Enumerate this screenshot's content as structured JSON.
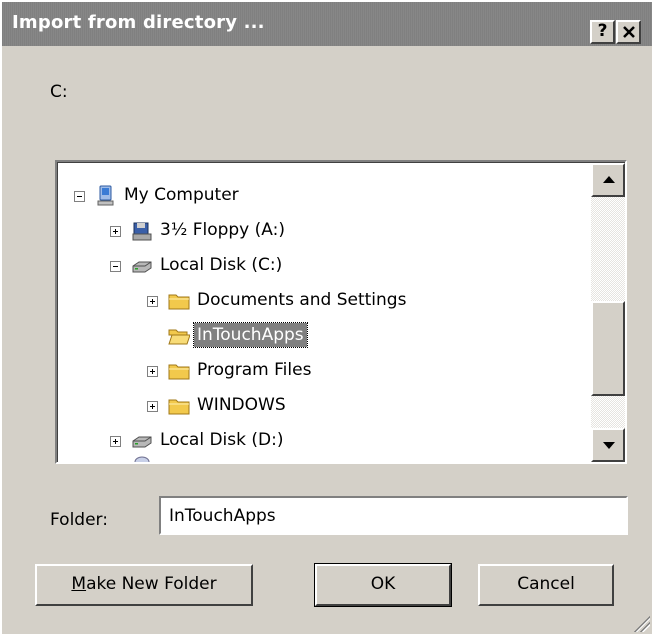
{
  "window": {
    "title": "Import from directory ...",
    "help_label": "?",
    "close_label": "✕"
  },
  "current_path": "C:",
  "tree": {
    "items": [
      {
        "label": "My Computer",
        "icon": "my-computer-icon",
        "expander": "minus"
      },
      {
        "label": "3½ Floppy (A:)",
        "icon": "floppy-drive-icon",
        "expander": "plus"
      },
      {
        "label": "Local Disk (C:)",
        "icon": "hard-disk-icon",
        "expander": "minus"
      },
      {
        "label": "Documents and Settings",
        "icon": "folder-icon",
        "expander": "plus"
      },
      {
        "label": "InTouchApps",
        "icon": "open-folder-icon",
        "expander": "none",
        "selected": true
      },
      {
        "label": "Program Files",
        "icon": "folder-icon",
        "expander": "plus"
      },
      {
        "label": "WINDOWS",
        "icon": "folder-icon",
        "expander": "plus"
      },
      {
        "label": "Local Disk (D:)",
        "icon": "hard-disk-icon",
        "expander": "plus"
      }
    ]
  },
  "folder": {
    "label": "Folder:",
    "value": "InTouchApps"
  },
  "buttons": {
    "new_folder_accel": "M",
    "new_folder_rest": "ake New Folder",
    "ok": "OK",
    "cancel": "Cancel"
  },
  "colors": {
    "dialog_face": "#d4d0c8",
    "title_bar": "#808080",
    "selection": "#808080",
    "folder": "#f2c94c"
  }
}
